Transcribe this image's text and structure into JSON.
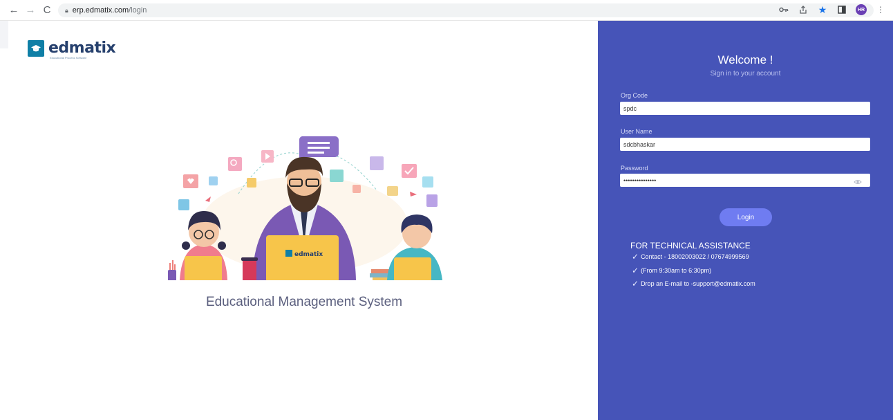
{
  "browser": {
    "url_host": "erp.edmatix.com",
    "url_path": "/login",
    "profile_initials": "HR"
  },
  "brand": {
    "logo_text": "edmatix",
    "logo_tagline": "Educational Process Software",
    "laptop_logo_text": "edmatix"
  },
  "left": {
    "system_title": "Educational Management System"
  },
  "login": {
    "welcome": "Welcome !",
    "subtitle": "Sign in to your account",
    "org_code_label": "Org Code",
    "org_code_value": "spdc",
    "username_label": "User Name",
    "username_value": "sdcbhaskar",
    "password_label": "Password",
    "password_value": "•••••••••••••••",
    "login_button": "Login"
  },
  "assistance": {
    "title": "FOR TECHNICAL ASSISTANCE",
    "items": [
      "Contact - 18002003022 / 07674999569",
      "(From 9:30am to 6:30pm)",
      "Drop an E-mail to -support@edmatix.com"
    ]
  },
  "colors": {
    "panel": "#4654b8",
    "button": "#6f7cf1",
    "logo": "#0f7fa6"
  },
  "icons": [
    "back-icon",
    "forward-icon",
    "reload-icon",
    "lock-icon",
    "key-icon",
    "share-icon",
    "star-icon",
    "sidepanel-icon",
    "profile-avatar",
    "menu-icon",
    "eye-icon",
    "check-icon"
  ]
}
